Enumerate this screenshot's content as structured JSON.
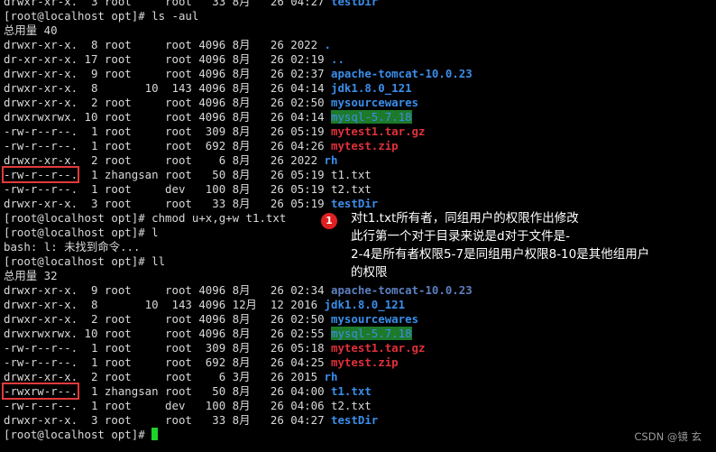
{
  "terminal": {
    "lines": [
      {
        "id": "l0",
        "segments": [
          {
            "t": "drwxr-xr-x.  3 root     root   33 8月   26 04:27 "
          },
          {
            "t": "testDir",
            "c": "blue"
          }
        ]
      },
      {
        "id": "l1",
        "segments": [
          {
            "t": "[root@localhost opt]# ls -aul"
          }
        ]
      },
      {
        "id": "l2",
        "segments": [
          {
            "t": "总用量 40"
          }
        ]
      },
      {
        "id": "l3",
        "segments": [
          {
            "t": "drwxr-xr-x.  8 root     root 4096 8月   26 2022 "
          },
          {
            "t": ".",
            "c": "blue"
          }
        ]
      },
      {
        "id": "l4",
        "segments": [
          {
            "t": "dr-xr-xr-x. 17 root     root 4096 8月   26 02:19 "
          },
          {
            "t": "..",
            "c": "blue"
          }
        ]
      },
      {
        "id": "l5",
        "segments": [
          {
            "t": "drwxr-xr-x.  9 root     root 4096 8月   26 02:37 "
          },
          {
            "t": "apache-tomcat-10.0.23",
            "c": "blue"
          }
        ]
      },
      {
        "id": "l6",
        "segments": [
          {
            "t": "drwxr-xr-x.  8       10  143 4096 8月   26 04:14 "
          },
          {
            "t": "jdk1.8.0_121",
            "c": "blue"
          }
        ]
      },
      {
        "id": "l7",
        "segments": [
          {
            "t": "drwxr-xr-x.  2 root     root 4096 8月   26 02:50 "
          },
          {
            "t": "mysourcewares",
            "c": "blue"
          }
        ]
      },
      {
        "id": "l8",
        "segments": [
          {
            "t": "drwxrwxrwx. 10 root     root 4096 8月   26 04:14 "
          },
          {
            "t": "mysql-5.7.18",
            "c": "hl"
          }
        ]
      },
      {
        "id": "l9",
        "segments": [
          {
            "t": "-rw-r--r--.  1 root     root  309 8月   26 05:19 "
          },
          {
            "t": "mytest1.tar.gz",
            "c": "red"
          }
        ]
      },
      {
        "id": "l10",
        "segments": [
          {
            "t": "-rw-r--r--.  1 root     root  692 8月   26 04:26 "
          },
          {
            "t": "mytest.zip",
            "c": "red"
          }
        ]
      },
      {
        "id": "l11",
        "segments": [
          {
            "t": "drwxr-xr-x.  2 root     root    6 8月   26 2022 "
          },
          {
            "t": "rh",
            "c": "blue"
          }
        ]
      },
      {
        "id": "l12",
        "segments": [
          {
            "t": "-rw-r--r--.",
            "box": true
          },
          {
            "t": "  1 zhangsan root   50 8月   26 05:19 t1.txt"
          }
        ]
      },
      {
        "id": "l13",
        "segments": [
          {
            "t": "-rw-r--r--.  1 root     dev   100 8月   26 05:19 t2.txt"
          }
        ]
      },
      {
        "id": "l14",
        "segments": [
          {
            "t": "drwxr-xr-x.  3 root     root   33 8月   26 05:19 "
          },
          {
            "t": "testDir",
            "c": "blue"
          }
        ]
      },
      {
        "id": "l15",
        "segments": [
          {
            "t": "[root@localhost opt]# chmod u+x,g+w t1.txt"
          }
        ]
      },
      {
        "id": "l16",
        "segments": [
          {
            "t": "[root@localhost opt]# l"
          }
        ]
      },
      {
        "id": "l17",
        "segments": [
          {
            "t": "bash: l: 未找到命令..."
          }
        ]
      },
      {
        "id": "l18",
        "segments": [
          {
            "t": "[root@localhost opt]# ll"
          }
        ]
      },
      {
        "id": "l19",
        "segments": [
          {
            "t": "总用量 32"
          }
        ]
      },
      {
        "id": "l20",
        "segments": [
          {
            "t": "drwxr-xr-x.  9 root     root 4096 8月   26 02:34 "
          },
          {
            "t": "apache-tomcat-10.0.23",
            "c": "dim"
          }
        ]
      },
      {
        "id": "l21",
        "segments": [
          {
            "t": "drwxr-xr-x.  8       10  143 4096 12月  12 2016 "
          },
          {
            "t": "jdk1.8.0_121",
            "c": "blue"
          }
        ]
      },
      {
        "id": "l22",
        "segments": [
          {
            "t": "drwxr-xr-x.  2 root     root 4096 8月   26 02:50 "
          },
          {
            "t": "mysourcewares",
            "c": "blue"
          }
        ]
      },
      {
        "id": "l23",
        "segments": [
          {
            "t": "drwxrwxrwx. 10 root     root 4096 8月   26 02:55 "
          },
          {
            "t": "mysql-5.7.18",
            "c": "hl"
          }
        ]
      },
      {
        "id": "l24",
        "segments": [
          {
            "t": "-rw-r--r--.  1 root     root  309 8月   26 05:18 "
          },
          {
            "t": "mytest1.tar.gz",
            "c": "red"
          }
        ]
      },
      {
        "id": "l25",
        "segments": [
          {
            "t": "-rw-r--r--.  1 root     root  692 8月   26 04:25 "
          },
          {
            "t": "mytest.zip",
            "c": "red"
          }
        ]
      },
      {
        "id": "l26",
        "segments": [
          {
            "t": "drwxr-xr-x.  2 root     root    6 3月   26 2015 "
          },
          {
            "t": "rh",
            "c": "blue"
          }
        ]
      },
      {
        "id": "l27",
        "segments": [
          {
            "t": "-rwxrw-r--.",
            "box": true
          },
          {
            "t": "  1 zhangsan root   50 8月   26 04:00 "
          },
          {
            "t": "t1.txt",
            "c": "blue"
          }
        ]
      },
      {
        "id": "l28",
        "segments": [
          {
            "t": "-rw-r--r--.  1 root     dev   100 8月   26 04:06 t2.txt"
          }
        ]
      },
      {
        "id": "l29",
        "segments": [
          {
            "t": "drwxr-xr-x.  3 root     root   33 8月   26 04:27 "
          },
          {
            "t": "testDir",
            "c": "blue"
          }
        ]
      },
      {
        "id": "l30",
        "segments": [
          {
            "t": "[root@localhost opt]# "
          }
        ],
        "cursor": true
      }
    ]
  },
  "annotation": {
    "badge": "1",
    "lines": [
      "对t1.txt所有者，同组用户的权限作出修改",
      "此行第一个对于目录来说是d对于文件是-",
      "2-4是所有者权限5-7是同组用户权限8-10是其他组用户",
      "的权限"
    ]
  },
  "watermark": "CSDN @镜 玄",
  "colors": {
    "background": "#000000",
    "text": "#d9d9d9",
    "dir": "#3b8eea",
    "archive": "#e0303a",
    "highlight_bg": "#1d7a2a",
    "box": "#e23a3a",
    "cursor": "#1fd12a",
    "badge": "#e02020"
  }
}
